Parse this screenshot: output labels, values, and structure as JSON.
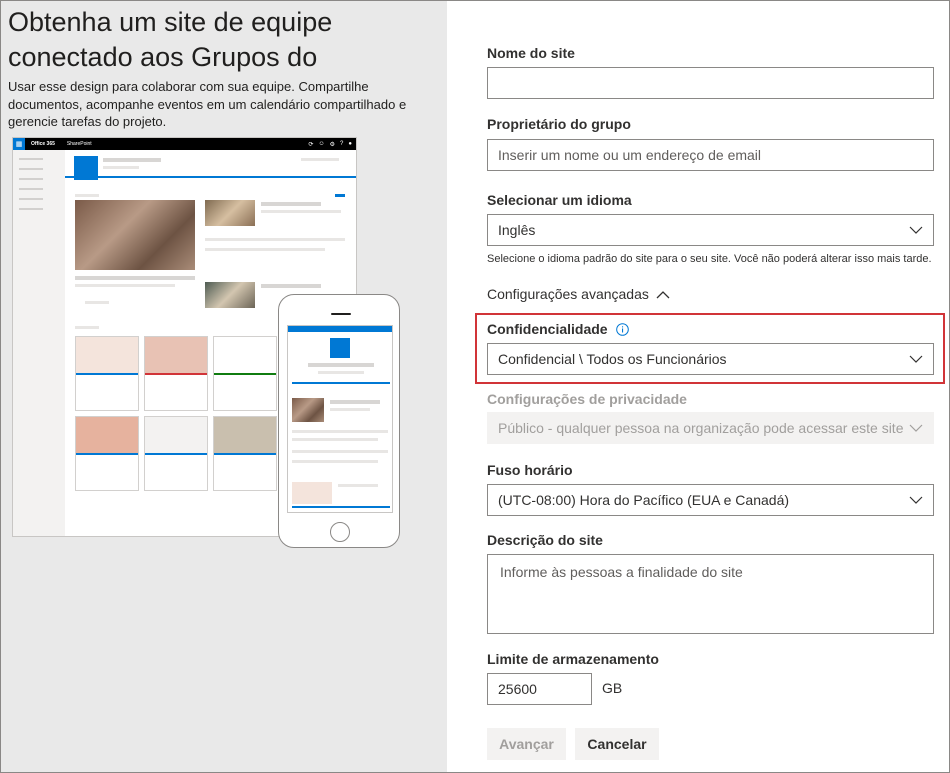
{
  "left": {
    "title": "Obtenha um site de equipe conectado aos Grupos do",
    "description": "Usar esse design para colaborar com sua equipe. Compartilhe documentos, acompanhe eventos em um calendário compartilhado e gerencie tarefas do projeto.",
    "preview": {
      "brand": "Office 365",
      "app": "SharePoint",
      "waffle_icon": "waffle-icon"
    }
  },
  "form": {
    "site_name": {
      "label": "Nome do site",
      "value": ""
    },
    "group_owner": {
      "label": "Proprietário do grupo",
      "placeholder": "Inserir um nome ou um endereço de email"
    },
    "language": {
      "label": "Selecionar um idioma",
      "value": "Inglês",
      "hint": "Selecione o idioma padrão do site para o seu site. Você não poderá alterar isso mais tarde."
    },
    "advanced": {
      "label": "Configurações avançadas",
      "icon": "chevron-up-icon"
    },
    "confidentiality": {
      "label": "Confidencialidade",
      "value": "Confidencial \\ Todos os Funcionários",
      "info_icon": "info-icon"
    },
    "privacy": {
      "label": "Configurações de privacidade",
      "value": "Público - qualquer pessoa na organização pode acessar este site"
    },
    "timezone": {
      "label": "Fuso horário",
      "value": "(UTC-08:00) Hora do Pacífico (EUA e Canadá)"
    },
    "description": {
      "label": "Descrição do site",
      "placeholder": "Informe às pessoas a finalidade do site"
    },
    "storage": {
      "label": "Limite de armazenamento",
      "value": "25600",
      "unit": "GB"
    },
    "buttons": {
      "next": "Avançar",
      "cancel": "Cancelar"
    }
  },
  "colors": {
    "accent": "#0078d4",
    "highlight": "#d13438",
    "left_bg": "#e9e9e9"
  }
}
